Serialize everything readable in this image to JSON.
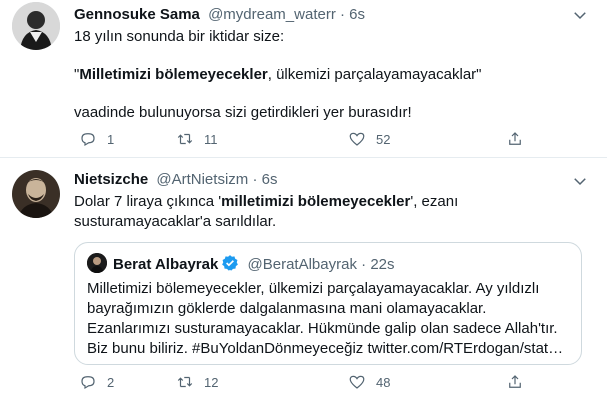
{
  "tweet1": {
    "author_name": "Gennosuke Sama",
    "author_handle": "@mydream_waterr",
    "separator": "·",
    "time": "6s",
    "line1": "18 yılın sonunda bir iktidar size:",
    "quote_open": "\"",
    "quote_bold": "Milletimizi bölemeyecekler",
    "quote_rest": ", ülkemizi parçalayamayacaklar\"",
    "line3": "vaadinde bulunuyorsa sizi getirdikleri yer burasıdır!",
    "replies": "1",
    "retweets": "11",
    "likes": "52"
  },
  "tweet2": {
    "author_name": "Nietsizche",
    "author_handle": "@ArtNietsizm",
    "separator": "·",
    "time": "6s",
    "body_pre": "Dolar 7 liraya çıkınca '",
    "body_bold": "milletimizi bölemeyecekler",
    "body_post": "', ezanı susturamayacaklar'a sarıldılar.",
    "replies": "2",
    "retweets": "12",
    "likes": "48"
  },
  "quoted": {
    "author_name": "Berat Albayrak",
    "author_handle": "@BeratAlbayrak",
    "separator": "·",
    "time": "22s",
    "text": "Milletimizi bölemeyecekler, ülkemizi parçalayamayacaklar. Ay yıldızlı bayrağımızın göklerde dalgalanmasına mani olamayacaklar. Ezanlarımızı susturamayacaklar. Hükmünde galip olan sadece Allah'tır. Biz bunu biliriz. #BuYoldanDönmeyeceğiz twitter.com/RTErdogan/stat…"
  },
  "icons": {
    "reply": "reply-icon",
    "retweet": "retweet-icon",
    "like": "heart-icon",
    "share": "share-icon",
    "more": "chevron-down-icon",
    "verified": "verified-badge-icon"
  },
  "colors": {
    "text": "#0f1419",
    "secondary": "#536471",
    "verified": "#1d9bf0",
    "divider": "#e6ecf0"
  }
}
